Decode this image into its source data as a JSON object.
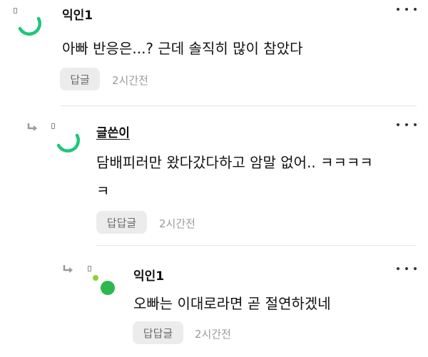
{
  "comments": [
    {
      "author": "익인1",
      "text": "아빠 반응은...? 근데 솔직히 많이 참았다",
      "reply_label": "답글",
      "time": "2시간전"
    },
    {
      "author": "글쓴이",
      "text_line1": "담배피러만 왔다갔다하고 암말 없어.. ㅋㅋㅋㅋ",
      "text_line2": "ㅋ",
      "reply_label": "답답글",
      "time": "2시간전"
    },
    {
      "author": "익인1",
      "text": "오빠는 이대로라면 곧 절연하겠네",
      "reply_label": "답답글",
      "time": "2시간전"
    }
  ],
  "colors": {
    "accent_green": "#1ec77a",
    "avatar_dot_green": "#2db84d",
    "avatar_dot_lime": "#8fd12a",
    "button_bg": "#ececec"
  },
  "icons": {
    "more": "more-dots-icon",
    "reply": "reply-arrow-icon",
    "avatar_arc": "avatar-arc-icon",
    "avatar_dots": "avatar-dots-icon"
  }
}
